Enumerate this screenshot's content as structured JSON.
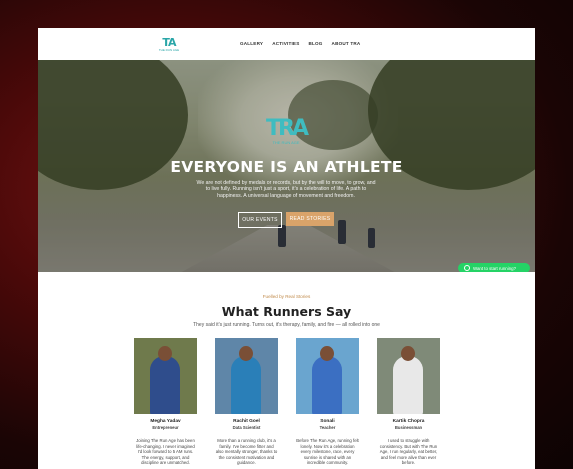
{
  "nav": {
    "logo": {
      "mark": "TA",
      "sub": "THE RUN AGE"
    },
    "menu": [
      "GALLERY",
      "ACTIVITIES",
      "BLOG",
      "ABOUT TRA"
    ]
  },
  "hero": {
    "logo": {
      "mark": "TRA",
      "sub": "THE RUN AGE"
    },
    "title": "EVERYONE IS AN ATHLETE",
    "text": "We are not defined by medals or records, but by the will to move, to grow, and to live fully. Running isn't just a sport, it's a celebration of life. A path to happiness. A universal language of movement and freedom.",
    "buttons": {
      "events": "OUR EVENTS",
      "stories": "READ STORIES"
    },
    "whatsapp": "Want to start running?"
  },
  "testimonials": {
    "kicker": "Fuelled by Real Stories",
    "title": "What Runners Say",
    "subtitle": "They said it's just running. Turns out, it's therapy, family, and fire — all rolled into one",
    "items": [
      {
        "name": "Megha Yadav",
        "role": "Entrepreneur",
        "quote": "Joining The Run Age has been life-changing. I never imagined I'd look forward to 5 AM runs. The energy, support, and discipline are unmatched.",
        "photo_bg": "#6f7a4c",
        "shirt": "#2f4d8c"
      },
      {
        "name": "Rachit Goel",
        "role": "Data Scientist",
        "quote": "More than a running club, it's a family. I've become fitter and also mentally stronger, thanks to the consistent motivation and guidance.",
        "photo_bg": "#5f86a8",
        "shirt": "#2a7fb8"
      },
      {
        "name": "Sonali",
        "role": "Teacher",
        "quote": "Before The Run Age, running felt lonely. Now it's a celebration every milestone, race, every sunrise is shared with an incredible community.",
        "photo_bg": "#6aa5cf",
        "shirt": "#3b6fc2"
      },
      {
        "name": "Kartik Chopra",
        "role": "Businessman",
        "quote": "I used to struggle with consistency. But with The Run Age, I run regularly, eat better, and feel more alive than ever before.",
        "photo_bg": "#7f8a78",
        "shirt": "#e8e8e8"
      }
    ]
  }
}
